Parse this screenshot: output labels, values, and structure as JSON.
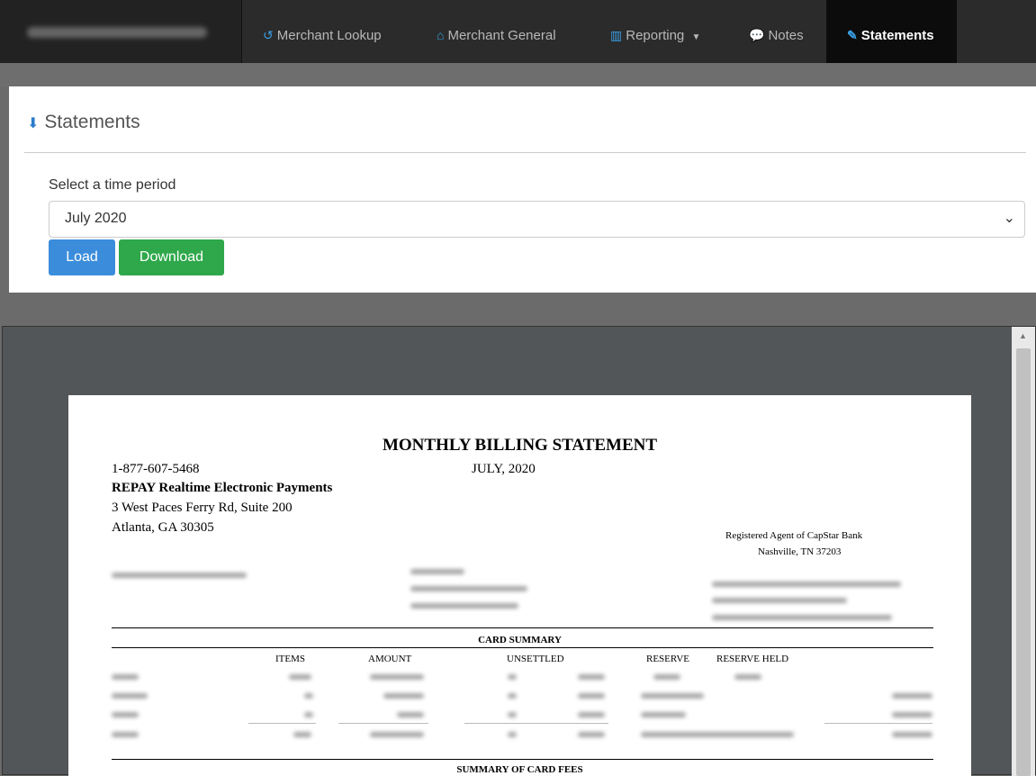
{
  "nav": {
    "brand": "",
    "items": [
      {
        "label": "Merchant Lookup",
        "icon": "refresh-icon"
      },
      {
        "label": "Merchant General",
        "icon": "home-icon"
      },
      {
        "label": "Reporting",
        "icon": "bar-chart-icon"
      },
      {
        "label": "Notes",
        "icon": "comments-icon"
      },
      {
        "label": "Statements",
        "icon": "paperclip-icon"
      }
    ],
    "active": "Statements",
    "accent_color": "#3a9fe6"
  },
  "panel": {
    "title": "Statements",
    "select_label": "Select a time period",
    "selected_period": "July 2020",
    "load_label": "Load",
    "download_label": "Download",
    "load_color": "#3b8ddc",
    "download_color": "#2ea84a"
  },
  "statement": {
    "title": "MONTHLY BILLING STATEMENT",
    "period": "JULY, 2020",
    "phone": "1-877-607-5468",
    "company": "REPAY Realtime Electronic Payments",
    "address1": "3 West Paces Ferry Rd, Suite 200",
    "address2": "Atlanta, GA 30305",
    "agent_line1": "Registered Agent of CapStar Bank",
    "agent_line2": "Nashville, TN 37203",
    "card_summary_title": "CARD SUMMARY",
    "columns": {
      "items": "ITEMS",
      "amount": "AMOUNT",
      "unsettled": "UNSETTLED",
      "reserve": "RESERVE",
      "reserve_held": "RESERVE HELD"
    },
    "fees_title": "SUMMARY OF CARD FEES"
  }
}
